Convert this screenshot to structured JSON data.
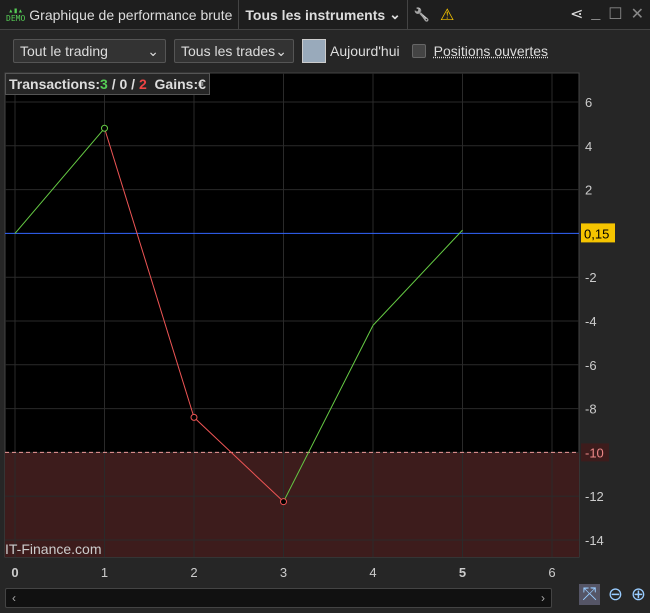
{
  "header": {
    "demo": "DEMO",
    "title": "Graphique de performance brute",
    "instruments": "Tous les instruments",
    "chevron": "⌄",
    "wrench": "🔧",
    "warning": "⚠",
    "share": "⋖",
    "minimize": "_",
    "maximize": "☐",
    "close": "✕"
  },
  "toolbar": {
    "trading": "Tout le trading",
    "trades": "Tous les trades",
    "today": "Aujourd'hui",
    "open_positions": "Positions ouvertes"
  },
  "info": {
    "label": "Transactions:",
    "wins": "3",
    "neutral": "0",
    "losses": "2",
    "sep": " / ",
    "gains": "Gains:€"
  },
  "watermark": "IT-Finance.com",
  "scroll": {
    "left": "‹",
    "right": "›"
  },
  "zoom": {
    "fit": "⤧",
    "out": "⊖",
    "in": "⊕"
  },
  "chart_data": {
    "type": "line",
    "x": [
      0,
      1,
      2,
      3,
      4,
      5
    ],
    "y": [
      0,
      4.8,
      -8.4,
      -12.25,
      -4.2,
      0.15
    ],
    "xlim": [
      0,
      6
    ],
    "ylim": [
      -14,
      6
    ],
    "x_ticks": [
      0,
      1,
      2,
      3,
      4,
      5,
      6
    ],
    "y_ticks": [
      6,
      4,
      2,
      -2,
      -4,
      -6,
      -8,
      -10,
      -12,
      -14
    ],
    "current_label": "0,15",
    "threshold": -10,
    "threshold_label": "-10",
    "baseline": 0,
    "colors": {
      "up": "#6c4",
      "down": "#e55",
      "baseline": "#36f",
      "zone": "#3d1c1c",
      "label_bg": "#f5c400"
    }
  }
}
